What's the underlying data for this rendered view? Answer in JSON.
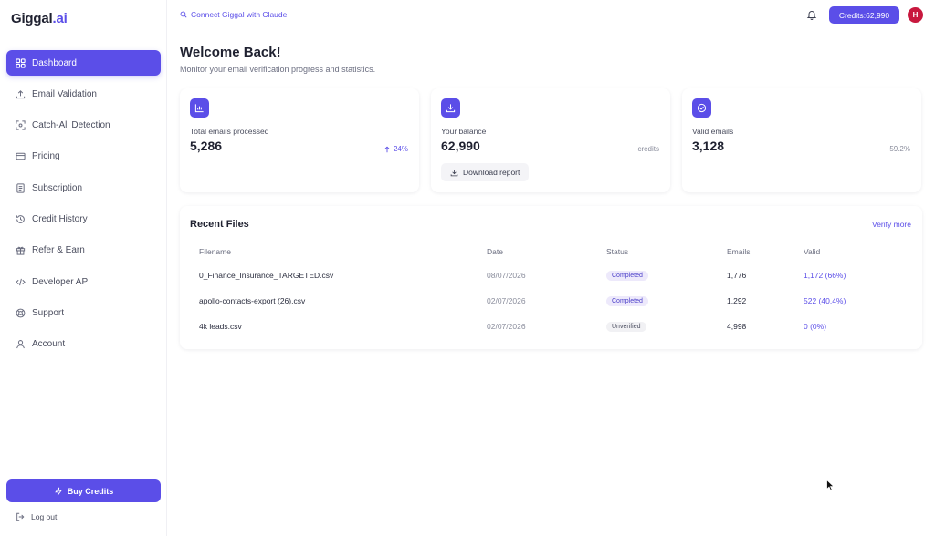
{
  "brand": {
    "name_part1": "Giggal",
    "name_part2": ".ai"
  },
  "sidebar": {
    "items": [
      {
        "label": "Dashboard",
        "icon": "grid-icon",
        "active": true
      },
      {
        "label": "Email Validation",
        "icon": "upload-icon"
      },
      {
        "label": "Catch-All Detection",
        "icon": "scan-icon"
      },
      {
        "label": "Pricing",
        "icon": "card-icon"
      },
      {
        "label": "Subscription",
        "icon": "receipt-icon"
      },
      {
        "label": "Credit History",
        "icon": "history-icon"
      },
      {
        "label": "Refer & Earn",
        "icon": "gift-icon"
      },
      {
        "label": "Developer API",
        "icon": "code-icon"
      },
      {
        "label": "Support",
        "icon": "lifebuoy-icon"
      },
      {
        "label": "Account",
        "icon": "user-icon"
      }
    ],
    "buy_credits": "Buy Credits",
    "logout": "Log out"
  },
  "topbar": {
    "connect": "Connect Giggal with Claude",
    "credits": "Credits:62,990",
    "avatar_initial": "H"
  },
  "welcome": {
    "title": "Welcome Back!",
    "subtitle": "Monitor your email verification progress and statistics."
  },
  "stats": [
    {
      "label": "Total emails processed",
      "value": "5,286",
      "right": "24%",
      "icon": "bar-chart-icon"
    },
    {
      "label": "Your balance",
      "value": "62,990",
      "right": "credits",
      "button": "Download report",
      "icon": "download-icon"
    },
    {
      "label": "Valid emails",
      "value": "3,128",
      "right": "59.2%",
      "icon": "check-circle-icon"
    }
  ],
  "recent_files": {
    "title": "Recent Files",
    "verify_more": "Verify more",
    "columns": [
      "Filename",
      "Date",
      "Status",
      "Emails",
      "Valid"
    ],
    "rows": [
      {
        "filename": "0_Finance_Insurance_TARGETED.csv",
        "date": "08/07/2026",
        "status": "Completed",
        "emails": "1,776",
        "valid": "1,172 (66%)"
      },
      {
        "filename": "apollo-contacts-export (26).csv",
        "date": "02/07/2026",
        "status": "Completed",
        "emails": "1,292",
        "valid": "522 (40.4%)"
      },
      {
        "filename": "4k leads.csv",
        "date": "02/07/2026",
        "status": "Unverified",
        "emails": "4,998",
        "valid": "0 (0%)"
      }
    ]
  },
  "colors": {
    "accent": "#5b4ee8",
    "avatar": "#c8183e"
  }
}
